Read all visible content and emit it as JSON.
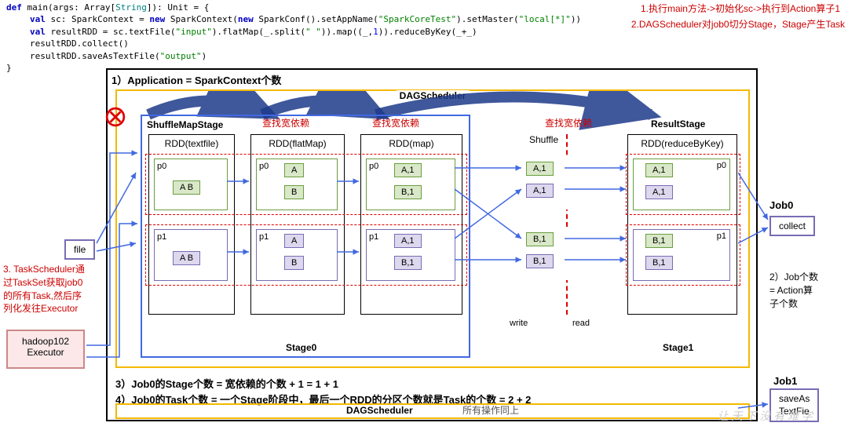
{
  "code": {
    "l1_def": "def",
    "l1_main": " main(args: Array[",
    "l1_string": "String",
    "l1_rest": "]): Unit = {",
    "l2_val": "val",
    "l2_sc": " sc: SparkContext = ",
    "l2_new": "new",
    "l2_sp": " SparkContext(",
    "l2_new2": "new",
    "l2_conf": " SparkConf().setAppName(",
    "l2_s1": "\"SparkCoreTest\"",
    "l2_mid": ").setMaster(",
    "l2_s2": "\"local[*]\"",
    "l2_end": "))",
    "l3_val": "val",
    "l3_a": " resultRDD = sc.textFile(",
    "l3_s1": "\"input\"",
    "l3_b": ").flatMap(_.split(",
    "l3_s2": "\" \"",
    "l3_c": ")).map((_,",
    "l3_n": "1",
    "l3_d": ")).reduceByKey(_+_)",
    "l4": "resultRDD.collect()",
    "l5_a": "resultRDD.saveAsTextFile(",
    "l5_s": "\"output\"",
    "l5_b": ")",
    "l6": "}"
  },
  "notes": {
    "n1": "1.执行main方法->初始化sc->执行到Action算子1",
    "n2": "2.DAGScheduler对job0切分Stage，Stage产生Task",
    "n3_1": "3. TaskScheduler通",
    "n3_2": "过TaskSet获取job0",
    "n3_3": "的所有Task,然后序",
    "n3_4": "列化发往Executor"
  },
  "diagram": {
    "title1": "1）Application = SparkContext个数",
    "dag": "DAGScheduler",
    "sms": "ShuffleMapStage",
    "rs": "ResultStage",
    "shuffle": "Shuffle",
    "rdd_tf": "RDD(textfile)",
    "rdd_fm": "RDD(flatMap)",
    "rdd_map": "RDD(map)",
    "rdd_rbk": "RDD(reduceByKey)",
    "p0": "p0",
    "p1": "p1",
    "AB": "A B",
    "A": "A",
    "B": "B",
    "A1": "A,1",
    "B1": "B,1",
    "stage0": "Stage0",
    "stage1": "Stage1",
    "dep": "查找宽依赖",
    "write": "write",
    "read": "read",
    "title3": "3）Job0的Stage个数 = 宽依赖的个数 + 1 = 1 + 1",
    "title4": "4）Job0的Task个数 = 一个Stage阶段中，最后一个RDD的分区个数就是Task的个数 = 2 + 2",
    "dag2extra": "所有操作同上",
    "file": "file",
    "collect": "collect",
    "job0": "Job0",
    "job1": "Job1",
    "saveAs": "saveAs\nTextFie",
    "jobcount1": "2）Job个数",
    "jobcount2": "= Action算",
    "jobcount3": "子个数",
    "executor1": "hadoop102",
    "executor2": "Executor",
    "watermark": "让 天 下 没 有 难 学"
  }
}
